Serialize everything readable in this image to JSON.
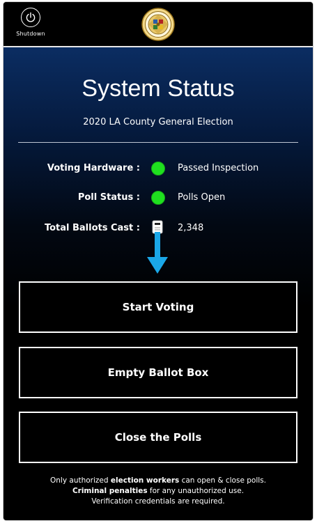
{
  "header": {
    "shutdown_label": "Shutdown",
    "shutdown_icon": "power-icon",
    "seal_icon": "county-seal-icon"
  },
  "main": {
    "title": "System Status",
    "subtitle": "2020 LA County General Election",
    "status": [
      {
        "label": "Voting Hardware :",
        "value": "Passed Inspection",
        "indicator": "green-status-dot",
        "color": "#1fe01f"
      },
      {
        "label": "Poll Status :",
        "value": "Polls Open",
        "indicator": "green-status-dot",
        "color": "#1fe01f"
      },
      {
        "label": "Total Ballots Cast :",
        "value": "2,348",
        "indicator": "ballot-icon"
      }
    ],
    "arrow_color": "#1aa7e8"
  },
  "buttons": {
    "start_voting": "Start Voting",
    "empty_ballot_box": "Empty Ballot Box",
    "close_polls": "Close the Polls"
  },
  "footer": {
    "line1_pre": "Only authorized ",
    "line1_bold": "election workers",
    "line1_post": " can open & close polls.",
    "line2_bold": "Criminal penalties",
    "line2_post": " for any unauthorized use.",
    "line3": "Verification credentials are required."
  }
}
